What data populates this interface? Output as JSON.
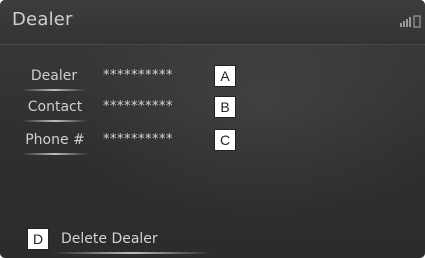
{
  "screen": {
    "title": "Dealer"
  },
  "status_bar": {
    "icons": [
      "signal-strength-icon",
      "battery-icon"
    ]
  },
  "fields": [
    {
      "label": "Dealer",
      "value": "**********",
      "callout": "A"
    },
    {
      "label": "Contact",
      "value": "**********",
      "callout": "B"
    },
    {
      "label": "Phone #",
      "value": "**********",
      "callout": "C"
    }
  ],
  "delete": {
    "label": "Delete Dealer",
    "callout": "D"
  }
}
